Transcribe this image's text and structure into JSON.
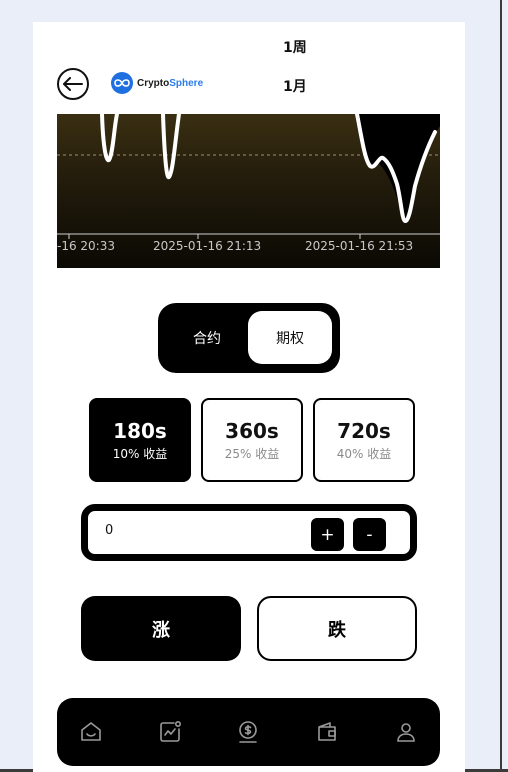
{
  "header": {
    "period_week": "1周",
    "period_month": "1月",
    "logo_text_main": "Crypto",
    "logo_text_accent": "Sphere"
  },
  "chart": {
    "tick_labels": [
      "-16 20:33",
      "2025-01-16 21:13",
      "2025-01-16 21:53"
    ],
    "line_color": "#ffffff",
    "background_color": "#2a220e"
  },
  "mode_toggle": {
    "option_contract": "合约",
    "option_options": "期权",
    "selected": "期权"
  },
  "durations": [
    {
      "time": "180s",
      "rate": "10% 收益",
      "active": true
    },
    {
      "time": "360s",
      "rate": "25% 收益",
      "active": false
    },
    {
      "time": "720s",
      "rate": "40% 收益",
      "active": false
    }
  ],
  "amount": {
    "value": "0",
    "plus_label": "+",
    "minus_label": "-"
  },
  "trade": {
    "up_label": "涨",
    "down_label": "跌"
  },
  "nav": {
    "icons": [
      "home-icon",
      "chart-icon",
      "dollar-icon",
      "wallet-icon",
      "user-icon"
    ]
  },
  "colors": {
    "primary": "#000000",
    "background": "#ffffff",
    "brand": "#1f6fe0"
  }
}
